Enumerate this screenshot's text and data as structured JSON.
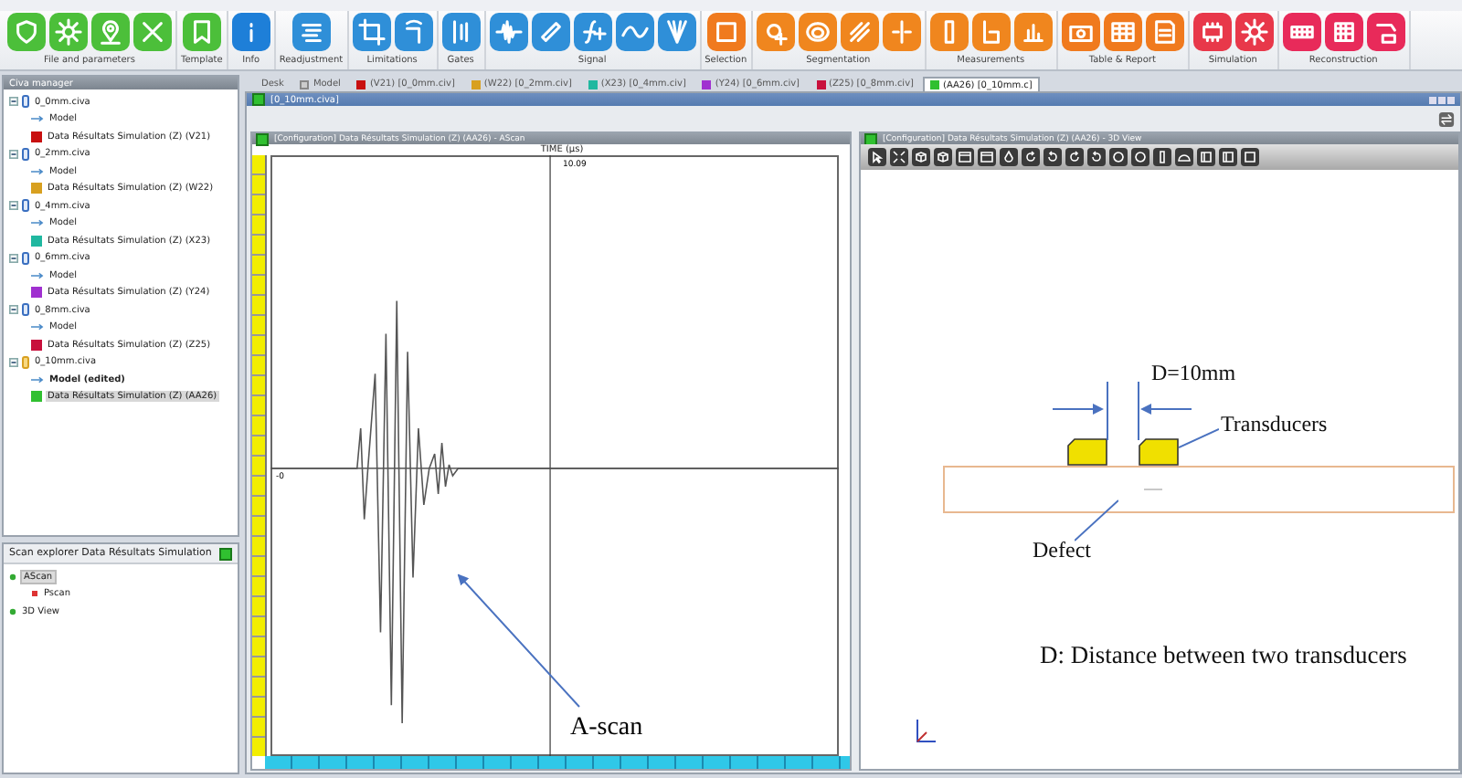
{
  "ribbon": {
    "groups": [
      {
        "label": "File and parameters",
        "color": "#4cbf3a"
      },
      {
        "label": "Template",
        "color": "#4cbf3a"
      },
      {
        "label": "Info",
        "color": "#1e7fd8"
      },
      {
        "label": "Readjustment",
        "color": "#2f8fd8"
      },
      {
        "label": "Limitations",
        "color": "#2f8fd8"
      },
      {
        "label": "Gates",
        "color": "#2f8fd8"
      },
      {
        "label": "Signal",
        "color": "#2f8fd8"
      },
      {
        "label": "Selection",
        "color": "#f07a1e"
      },
      {
        "label": "Segmentation",
        "color": "#f0861e"
      },
      {
        "label": "Measurements",
        "color": "#f0861e"
      },
      {
        "label": "Table & Report",
        "color": "#f07a1e"
      },
      {
        "label": "Simulation",
        "color": "#e8384a"
      },
      {
        "label": "Reconstruction",
        "color": "#e82a5a"
      }
    ]
  },
  "tabs": [
    {
      "label": "Desk",
      "kind": "desk",
      "selected": false
    },
    {
      "label": "Model",
      "kind": "model",
      "selected": false
    },
    {
      "label": "(V21) [0_0mm.civ]",
      "kind": "data",
      "color": "#c81010",
      "selected": false
    },
    {
      "label": "(W22) [0_2mm.civ]",
      "kind": "data",
      "color": "#d8a020",
      "selected": false
    },
    {
      "label": "(X23) [0_4mm.civ]",
      "kind": "data",
      "color": "#20b8a0",
      "selected": false
    },
    {
      "label": "(Y24) [0_6mm.civ]",
      "kind": "data",
      "color": "#a030d0",
      "selected": false
    },
    {
      "label": "(Z25) [0_8mm.civ]",
      "kind": "data",
      "color": "#c8103c",
      "selected": false
    },
    {
      "label": "(AA26) [0_10mm.c]",
      "kind": "data",
      "color": "#30c030",
      "selected": true
    }
  ],
  "civa_manager": {
    "title": "Civa manager",
    "files": [
      {
        "label": "0_0mm.civa",
        "active": false,
        "children": [
          {
            "label": "Model",
            "kind": "model",
            "edited": false
          },
          {
            "label": "Data Résultats Simulation (Z) (V21)",
            "kind": "data",
            "color": "#c81010",
            "selected": false
          }
        ]
      },
      {
        "label": "0_2mm.civa",
        "active": false,
        "children": [
          {
            "label": "Model",
            "kind": "model",
            "edited": false
          },
          {
            "label": "Data Résultats Simulation (Z) (W22)",
            "kind": "data",
            "color": "#d8a020",
            "selected": false
          }
        ]
      },
      {
        "label": "0_4mm.civa",
        "active": false,
        "children": [
          {
            "label": "Model",
            "kind": "model",
            "edited": false
          },
          {
            "label": "Data Résultats Simulation (Z) (X23)",
            "kind": "data",
            "color": "#20b8a0",
            "selected": false
          }
        ]
      },
      {
        "label": "0_6mm.civa",
        "active": false,
        "children": [
          {
            "label": "Model",
            "kind": "model",
            "edited": false
          },
          {
            "label": "Data Résultats Simulation (Z) (Y24)",
            "kind": "data",
            "color": "#a030d0",
            "selected": false
          }
        ]
      },
      {
        "label": "0_8mm.civa",
        "active": false,
        "children": [
          {
            "label": "Model",
            "kind": "model",
            "edited": false
          },
          {
            "label": "Data Résultats Simulation (Z) (Z25)",
            "kind": "data",
            "color": "#c8103c",
            "selected": false
          }
        ]
      },
      {
        "label": "0_10mm.civa",
        "active": true,
        "children": [
          {
            "label": "Model (edited)",
            "kind": "model",
            "edited": true
          },
          {
            "label": "Data Résultats Simulation (Z) (AA26)",
            "kind": "data",
            "color": "#30c030",
            "selected": true
          }
        ]
      }
    ]
  },
  "scan_explorer": {
    "title": "Scan explorer Data Résultats Simulation",
    "items": [
      {
        "label": "AScan",
        "selected": true,
        "children": [
          {
            "label": "Pscan",
            "selected": false
          }
        ]
      },
      {
        "label": "3D View",
        "selected": false
      }
    ]
  },
  "document": {
    "title": "[0_10mm.civa]"
  },
  "ascan_view": {
    "title": "[Configuration] Data Résultats Simulation (Z) (AA26) - AScan",
    "axis_title": "TIME (µs)",
    "cursor_value": "10.09",
    "baseline_label": "-0",
    "annotation": "A-scan"
  },
  "view_3d": {
    "title": "[Configuration] Data Résultats Simulation (Z) (AA26) - 3D View",
    "dimension_label": "D=10mm",
    "transducers_label": "Transducers",
    "defect_label": "Defect",
    "caption": "D: Distance between two transducers"
  }
}
